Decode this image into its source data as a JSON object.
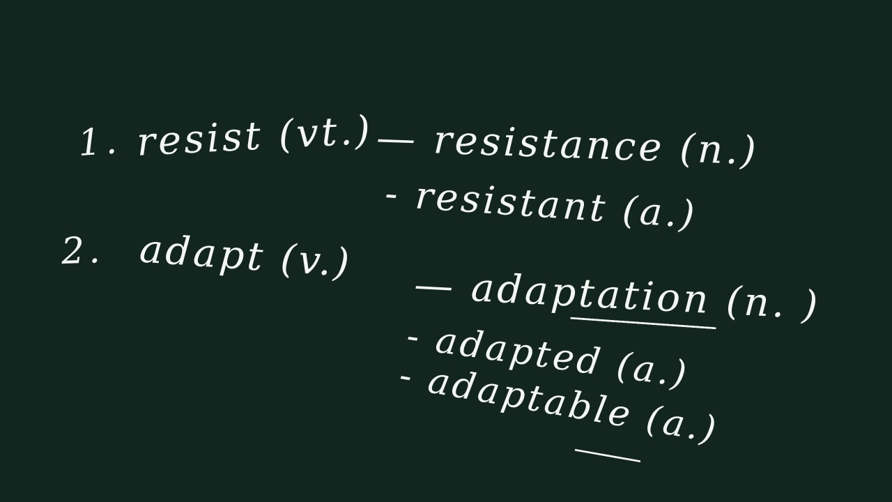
{
  "background_color": "#12261f",
  "chalk_color": "#f4f6f3",
  "items": [
    {
      "number": "1.",
      "base": "resist (vt.)",
      "derived": [
        {
          "text": "— resistance (n.)"
        },
        {
          "text": "- resistant (a.)"
        }
      ]
    },
    {
      "number": "2.",
      "base": "adapt (v.)",
      "derived": [
        {
          "text": "— adaptation (n. )"
        },
        {
          "text": "- adapted (a.)"
        },
        {
          "text": "- adaptable (a.)"
        }
      ]
    }
  ]
}
